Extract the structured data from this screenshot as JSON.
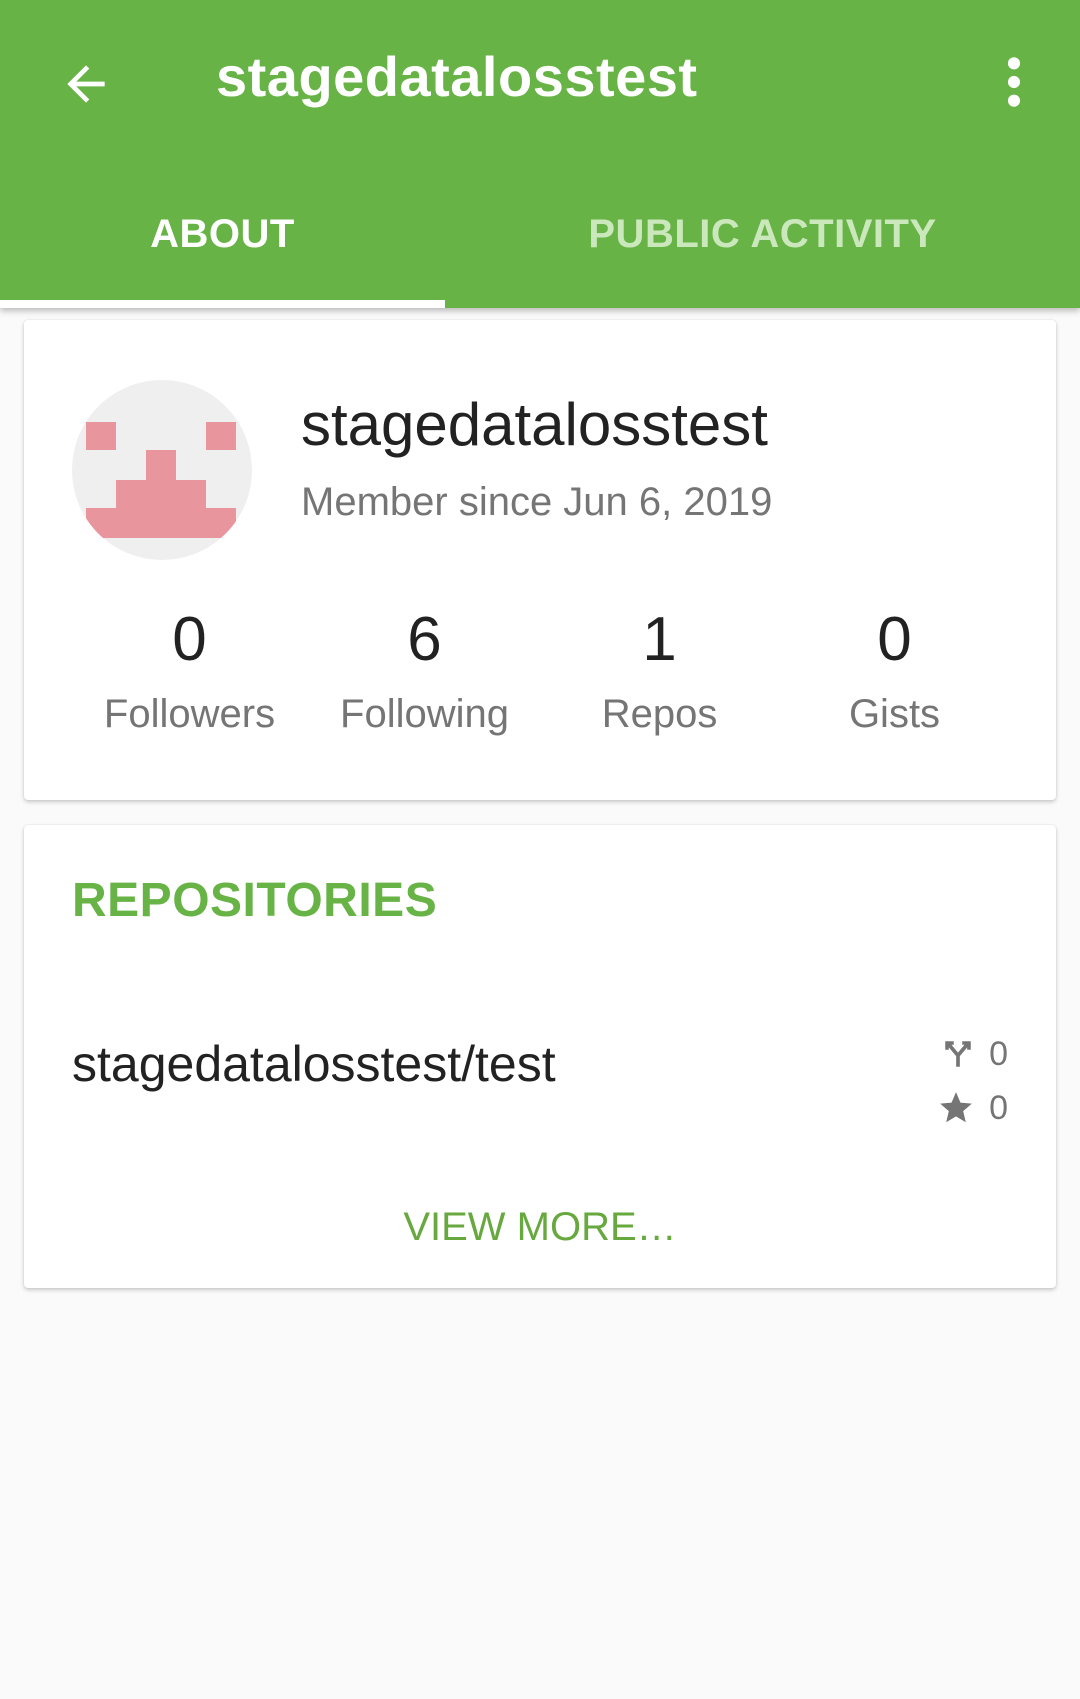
{
  "appbar": {
    "title": "stagedatalosstest",
    "back_icon": "arrow-back-icon",
    "overflow_icon": "more-vert-icon",
    "color": "#67b346"
  },
  "tabs": [
    {
      "label": "ABOUT",
      "active": true
    },
    {
      "label": "PUBLIC ACTIVITY",
      "active": false
    }
  ],
  "profile": {
    "username": "stagedatalosstest",
    "member_since": "Member since Jun 6, 2019",
    "avatar_color": "#e8959e",
    "stats": [
      {
        "value": "0",
        "label": "Followers"
      },
      {
        "value": "6",
        "label": "Following"
      },
      {
        "value": "1",
        "label": "Repos"
      },
      {
        "value": "0",
        "label": "Gists"
      }
    ]
  },
  "repositories": {
    "title": "REPOSITORIES",
    "items": [
      {
        "name": "stagedatalosstest/test",
        "forks": "0",
        "stars": "0"
      }
    ],
    "view_more": "VIEW MORE…"
  }
}
